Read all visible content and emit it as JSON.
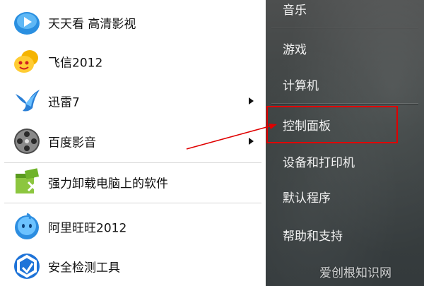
{
  "programs": [
    {
      "label": "天天看 高清影视",
      "icon": "tiantiankan-tv-icon",
      "has_submenu": false
    },
    {
      "label": "飞信2012",
      "icon": "fetion-icon",
      "has_submenu": false
    },
    {
      "label": "迅雷7",
      "icon": "thunder-bird-icon",
      "has_submenu": true
    },
    {
      "label": "百度影音",
      "icon": "baidu-player-reel-icon",
      "has_submenu": true
    },
    {
      "label": "强力卸载电脑上的软件",
      "icon": "uninstall-tool-icon",
      "has_submenu": false
    },
    {
      "label": "阿里旺旺2012",
      "icon": "aliwangwang-icon",
      "has_submenu": false
    },
    {
      "label": "安全检测工具",
      "icon": "security-check-icon",
      "has_submenu": false
    }
  ],
  "system_links": [
    {
      "label": "音乐"
    },
    {
      "label": "游戏"
    },
    {
      "label": "计算机"
    },
    {
      "label": "控制面板"
    },
    {
      "label": "设备和打印机"
    },
    {
      "label": "默认程序"
    },
    {
      "label": "帮助和支持"
    }
  ],
  "annotation": {
    "highlight_target": "控制面板",
    "highlight_color": "#e00000"
  },
  "watermark": {
    "text": "爱创根知识网"
  },
  "colors": {
    "right_pane": "#3f4445",
    "right_text": "#f2f2f2",
    "left_text": "#111111"
  }
}
